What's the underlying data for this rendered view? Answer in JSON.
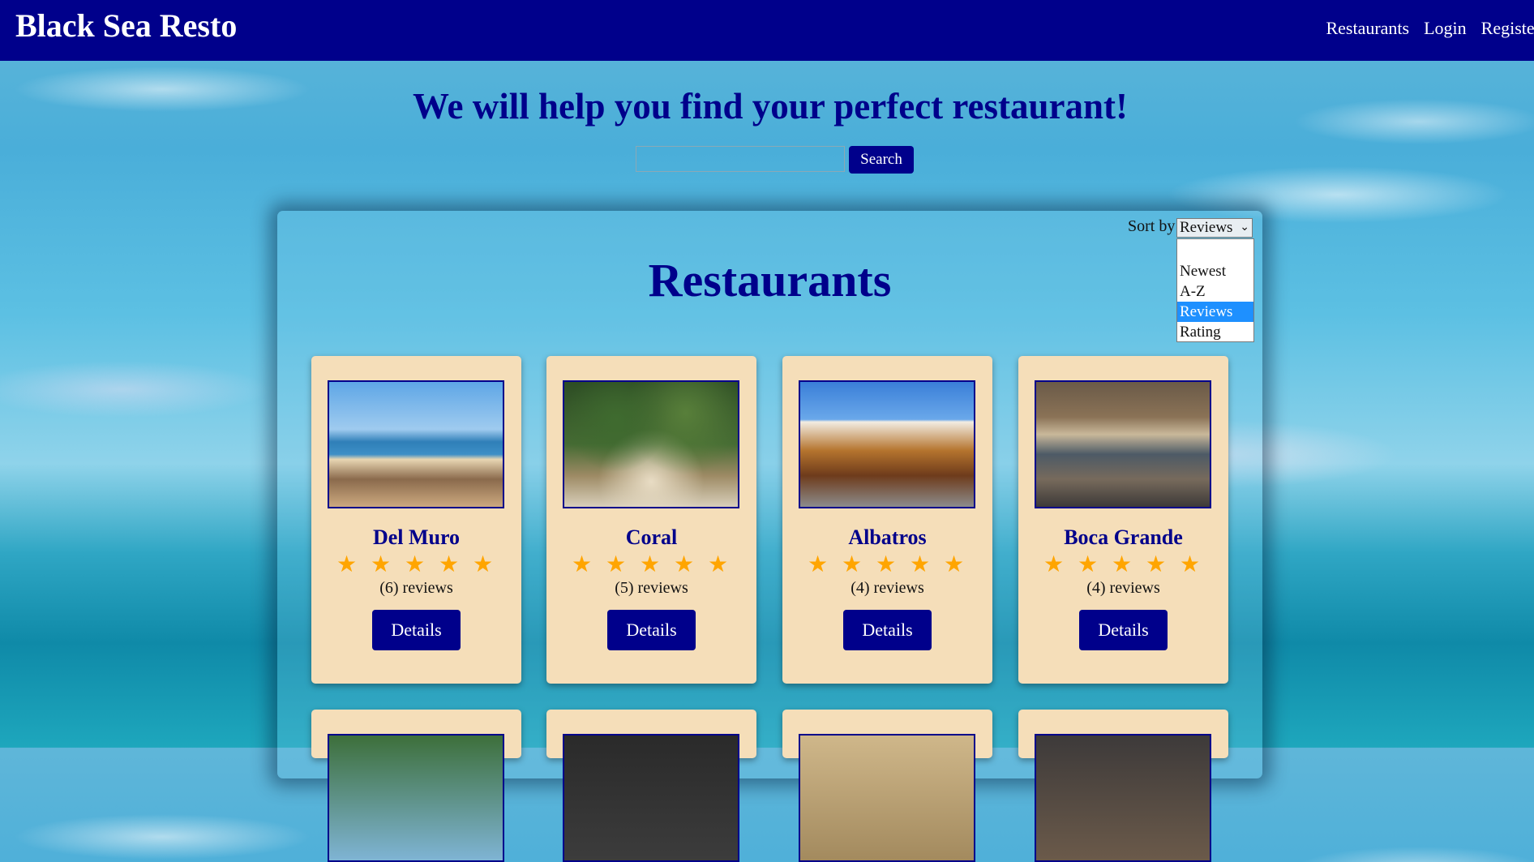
{
  "header": {
    "brand": "Black Sea Resto",
    "nav": [
      "Restaurants",
      "Login",
      "Register"
    ]
  },
  "hero": {
    "title": "We will help you find your perfect restaurant!",
    "search_value": "",
    "search_button": "Search"
  },
  "panel": {
    "title": "Restaurants",
    "sort_label": "Sort by",
    "sort_selected": "Reviews",
    "sort_options": [
      "",
      "Newest",
      "A-Z",
      "Reviews",
      "Rating"
    ]
  },
  "restaurants": [
    {
      "name": "Del Muro",
      "stars": "★ ★ ★ ★ ★",
      "rating": 5,
      "reviews": "(6) reviews",
      "details": "Details"
    },
    {
      "name": "Coral",
      "stars": "★ ★ ★ ★ ★",
      "rating": 5,
      "reviews": "(5) reviews",
      "details": "Details"
    },
    {
      "name": "Albatros",
      "stars": "★ ★ ★ ★ ★",
      "rating": 5,
      "reviews": "(4) reviews",
      "details": "Details"
    },
    {
      "name": "Boca Grande",
      "stars": "★ ★ ★ ★ ★",
      "rating": 5,
      "reviews": "(4) reviews",
      "details": "Details"
    }
  ],
  "colors": {
    "navy": "#00008b",
    "card": "#f5deb9",
    "star": "#ffa500",
    "selected_option": "#1e90ff"
  }
}
